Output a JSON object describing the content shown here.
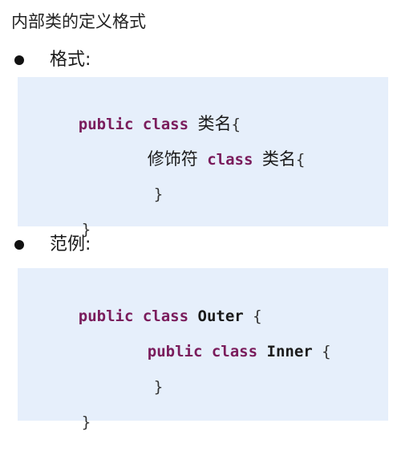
{
  "title": "内部类的定义格式",
  "sections": [
    {
      "label": "格式:",
      "lines": [
        {
          "kw1": "public",
          "kw2": "class",
          "name": "类名",
          "brace": "{"
        },
        {
          "mod": "修饰符",
          "kw": "class",
          "name": "类名",
          "brace": "{"
        },
        {
          "brace": "}"
        },
        {
          "brace": "}"
        }
      ]
    },
    {
      "label": "范例:",
      "lines": [
        {
          "kw1": "public",
          "kw2": "class",
          "name": "Outer",
          "brace": "{"
        },
        {
          "kw1": "public",
          "kw2": "class",
          "name": "Inner",
          "brace": "{"
        },
        {
          "brace": "}"
        },
        {
          "brace": "}"
        }
      ]
    }
  ]
}
